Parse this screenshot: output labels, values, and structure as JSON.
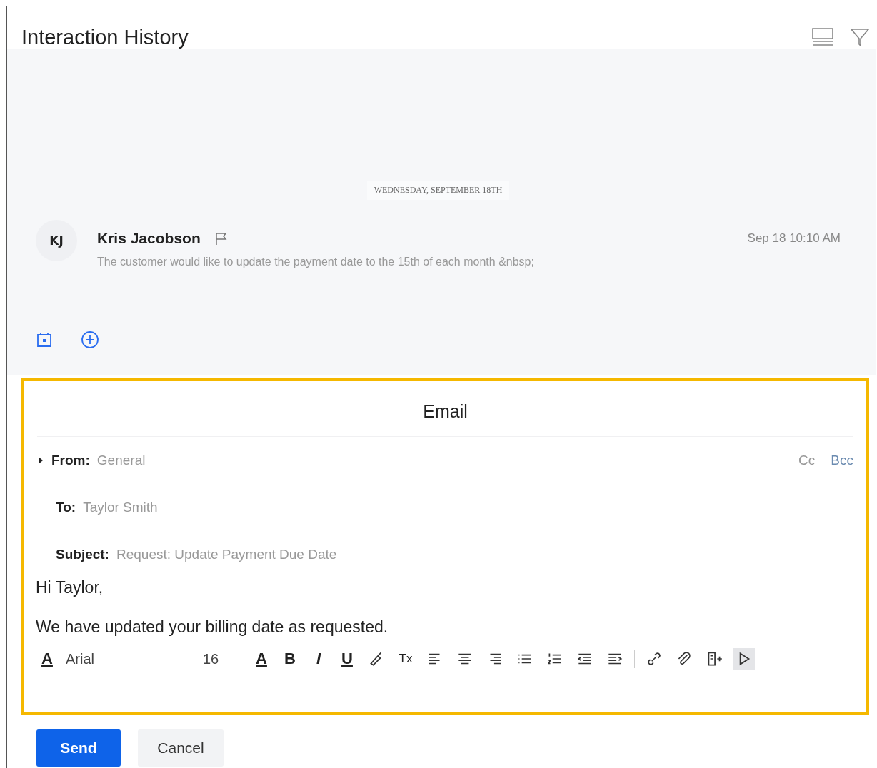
{
  "header": {
    "title": "Interaction History"
  },
  "timeline": {
    "date": "WEDNESDAY, SEPTEMBER 18TH",
    "entries": [
      {
        "initials": "KJ",
        "name": "Kris Jacobson",
        "flagged": false,
        "time": "Sep 18 10:10 AM",
        "text": "The customer would like to update the payment date to the 15th of each month &nbsp;"
      }
    ]
  },
  "email": {
    "title": "Email",
    "from_label": "From:",
    "from": "General",
    "cc": "Cc",
    "bcc": "Bcc",
    "to_label": "To:",
    "to": "Taylor Smith",
    "subject_label": "Subject:",
    "subject": "Request: Update Payment Due Date",
    "body": [
      "Hi Taylor,",
      "We have updated your billing date as requested."
    ],
    "toolbar": {
      "color_label": "A",
      "font": "Arial",
      "size": "16",
      "items": [
        {
          "kind": "letter",
          "label": "A"
        },
        {
          "kind": "letter",
          "label": "B"
        },
        {
          "kind": "letter",
          "label": "I"
        },
        {
          "kind": "letter",
          "label": "U"
        },
        {
          "kind": "icon"
        },
        {
          "kind": "letter",
          "label": "Tx"
        },
        {
          "kind": "icon"
        },
        {
          "kind": "icon"
        },
        {
          "kind": "icon"
        },
        {
          "kind": "icon"
        },
        {
          "kind": "icon"
        },
        {
          "kind": "icon"
        },
        {
          "kind": "icon"
        },
        {
          "kind": "divider"
        },
        {
          "kind": "icon"
        },
        {
          "kind": "icon"
        },
        {
          "kind": "icon"
        },
        {
          "kind": "icon",
          "highlighted": true
        }
      ]
    }
  },
  "actions": [
    {
      "label": "Send",
      "kind": "primary"
    },
    {
      "label": "Cancel",
      "kind": "secondary"
    }
  ]
}
